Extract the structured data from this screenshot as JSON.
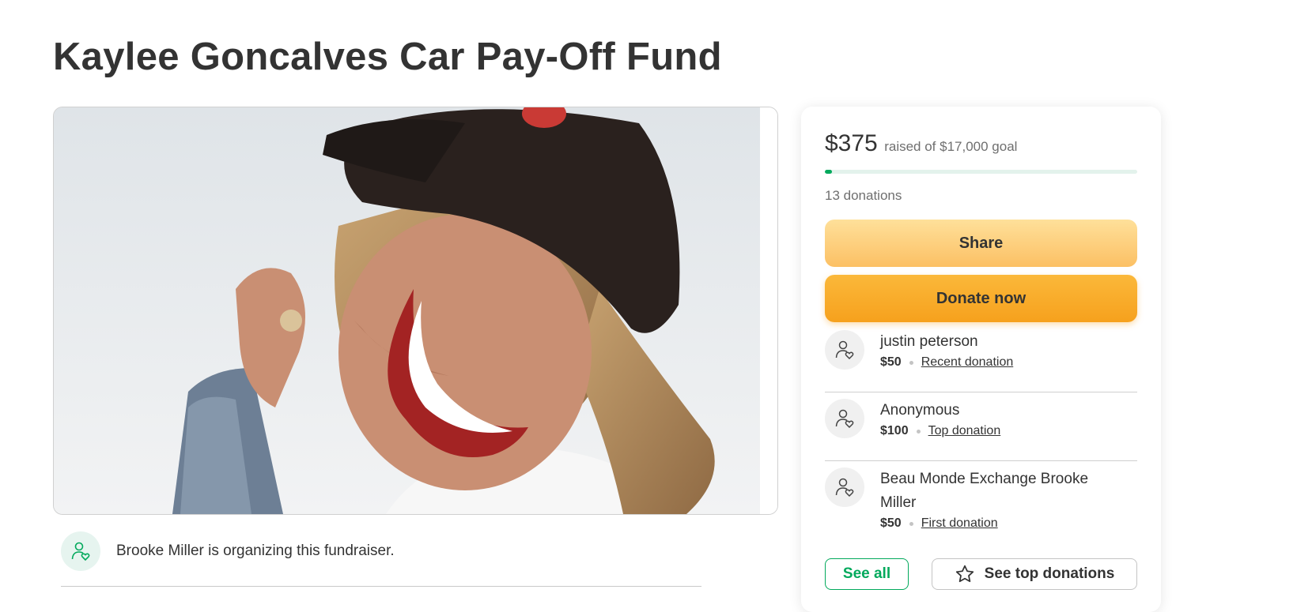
{
  "page": {
    "title": "Kaylee Goncalves Car Pay-Off Fund"
  },
  "hero_image": {
    "alt": "Smiling woman wearing a dark baseball cap and denim jacket"
  },
  "organizer": {
    "text": "Brooke Miller is organizing this fundraiser.",
    "icon": "user-heart-icon"
  },
  "donation_card": {
    "raised_amount": "$375",
    "raised_label": "raised of $17,000 goal",
    "progress_fraction": 0.022,
    "donation_count": "13 donations",
    "share_label": "Share",
    "donate_label": "Donate now",
    "donors": [
      {
        "name": "justin peterson",
        "amount": "$50",
        "tag": "Recent donation",
        "icon": "user-heart-icon"
      },
      {
        "name": "Anonymous",
        "amount": "$100",
        "tag": "Top donation",
        "icon": "user-heart-icon"
      },
      {
        "name": "Beau Monde Exchange Brooke Miller",
        "amount": "$50",
        "tag": "First donation",
        "icon": "user-heart-icon"
      }
    ],
    "see_all_label": "See all",
    "see_top_label": "See top donations",
    "see_top_icon": "star-icon"
  },
  "colors": {
    "accent_green": "#02a95c",
    "share_button": "#fcc064",
    "donate_button": "#f6a11d",
    "progress_track": "#e3f2ec"
  }
}
